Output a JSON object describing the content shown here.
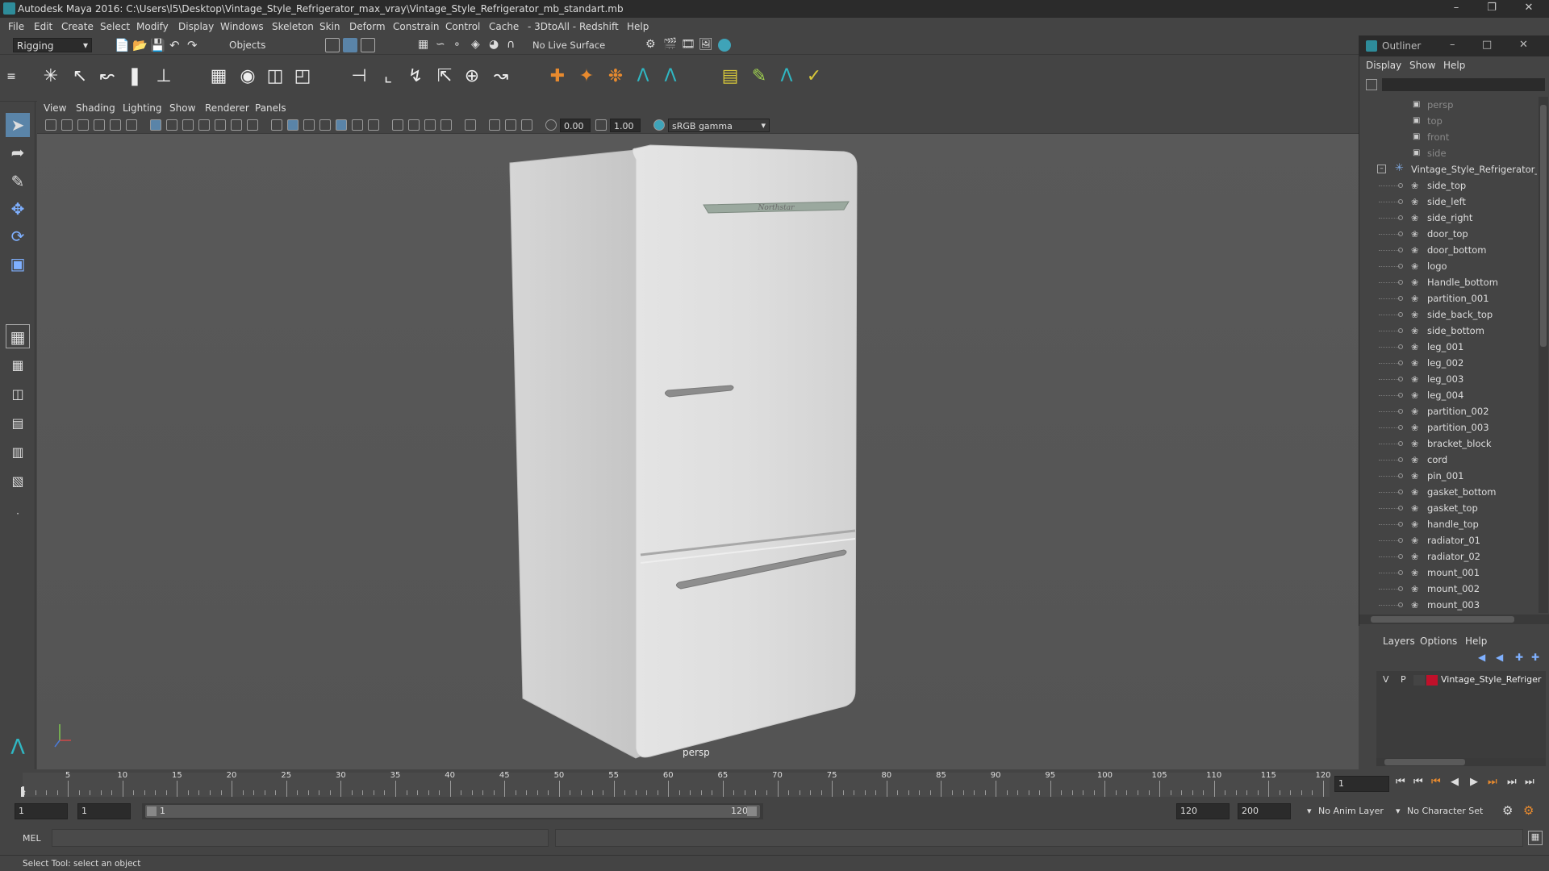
{
  "window": {
    "title": "Autodesk Maya 2016: C:\\Users\\l5\\Desktop\\Vintage_Style_Refrigerator_max_vray\\Vintage_Style_Refrigerator_mb_standart.mb"
  },
  "menubar": [
    "File",
    "Edit",
    "Create",
    "Select",
    "Modify",
    "Display",
    "Windows",
    "Skeleton",
    "Skin",
    "Deform",
    "Constrain",
    "Control",
    "Cache",
    "- 3DtoAll -",
    "Redshift",
    "Help"
  ],
  "statusline": {
    "mode": "Rigging",
    "select_mode": "Objects",
    "live_surface": "No Live Surface"
  },
  "viewport": {
    "menus": [
      "View",
      "Shading",
      "Lighting",
      "Show",
      "Renderer",
      "Panels"
    ],
    "exposure": "0.00",
    "gamma": "1.00",
    "color_space": "sRGB gamma",
    "camera_label": "persp",
    "logo_text": "Northstar"
  },
  "outliner": {
    "title": "Outliner",
    "menus": [
      "Display",
      "Show",
      "Help"
    ],
    "cameras": [
      "persp",
      "top",
      "front",
      "side"
    ],
    "group": "Vintage_Style_Refrigerator_ncl",
    "children": [
      "side_top",
      "side_left",
      "side_right",
      "door_top",
      "door_bottom",
      "logo",
      "Handle_bottom",
      "partition_001",
      "side_back_top",
      "side_bottom",
      "leg_001",
      "leg_002",
      "leg_003",
      "leg_004",
      "partition_002",
      "partition_003",
      "bracket_block",
      "cord",
      "pin_001",
      "gasket_bottom",
      "gasket_top",
      "handle_top",
      "radiator_01",
      "radiator_02",
      "mount_001",
      "mount_002",
      "mount_003"
    ]
  },
  "layers": {
    "menus": [
      "Layers",
      "Options",
      "Help"
    ],
    "layer": {
      "v": "V",
      "p": "P",
      "name": "Vintage_Style_Refriger",
      "color": "#c0102a"
    }
  },
  "timeline": {
    "ticks": [
      "5",
      "10",
      "15",
      "20",
      "25",
      "30",
      "35",
      "40",
      "45",
      "50",
      "55",
      "60",
      "65",
      "70",
      "75",
      "80",
      "85",
      "90",
      "95",
      "100",
      "105",
      "110",
      "115",
      "120"
    ],
    "start_tick": "1",
    "current_frame": "1"
  },
  "range": {
    "start": "1",
    "playback_start": "1",
    "range_start": "1",
    "range_end": "120",
    "end": "120",
    "anim_end": "200",
    "anim_layer": "No Anim Layer",
    "char_set": "No Character Set"
  },
  "cmd": {
    "lang": "MEL"
  },
  "help": "Select Tool: select an object"
}
